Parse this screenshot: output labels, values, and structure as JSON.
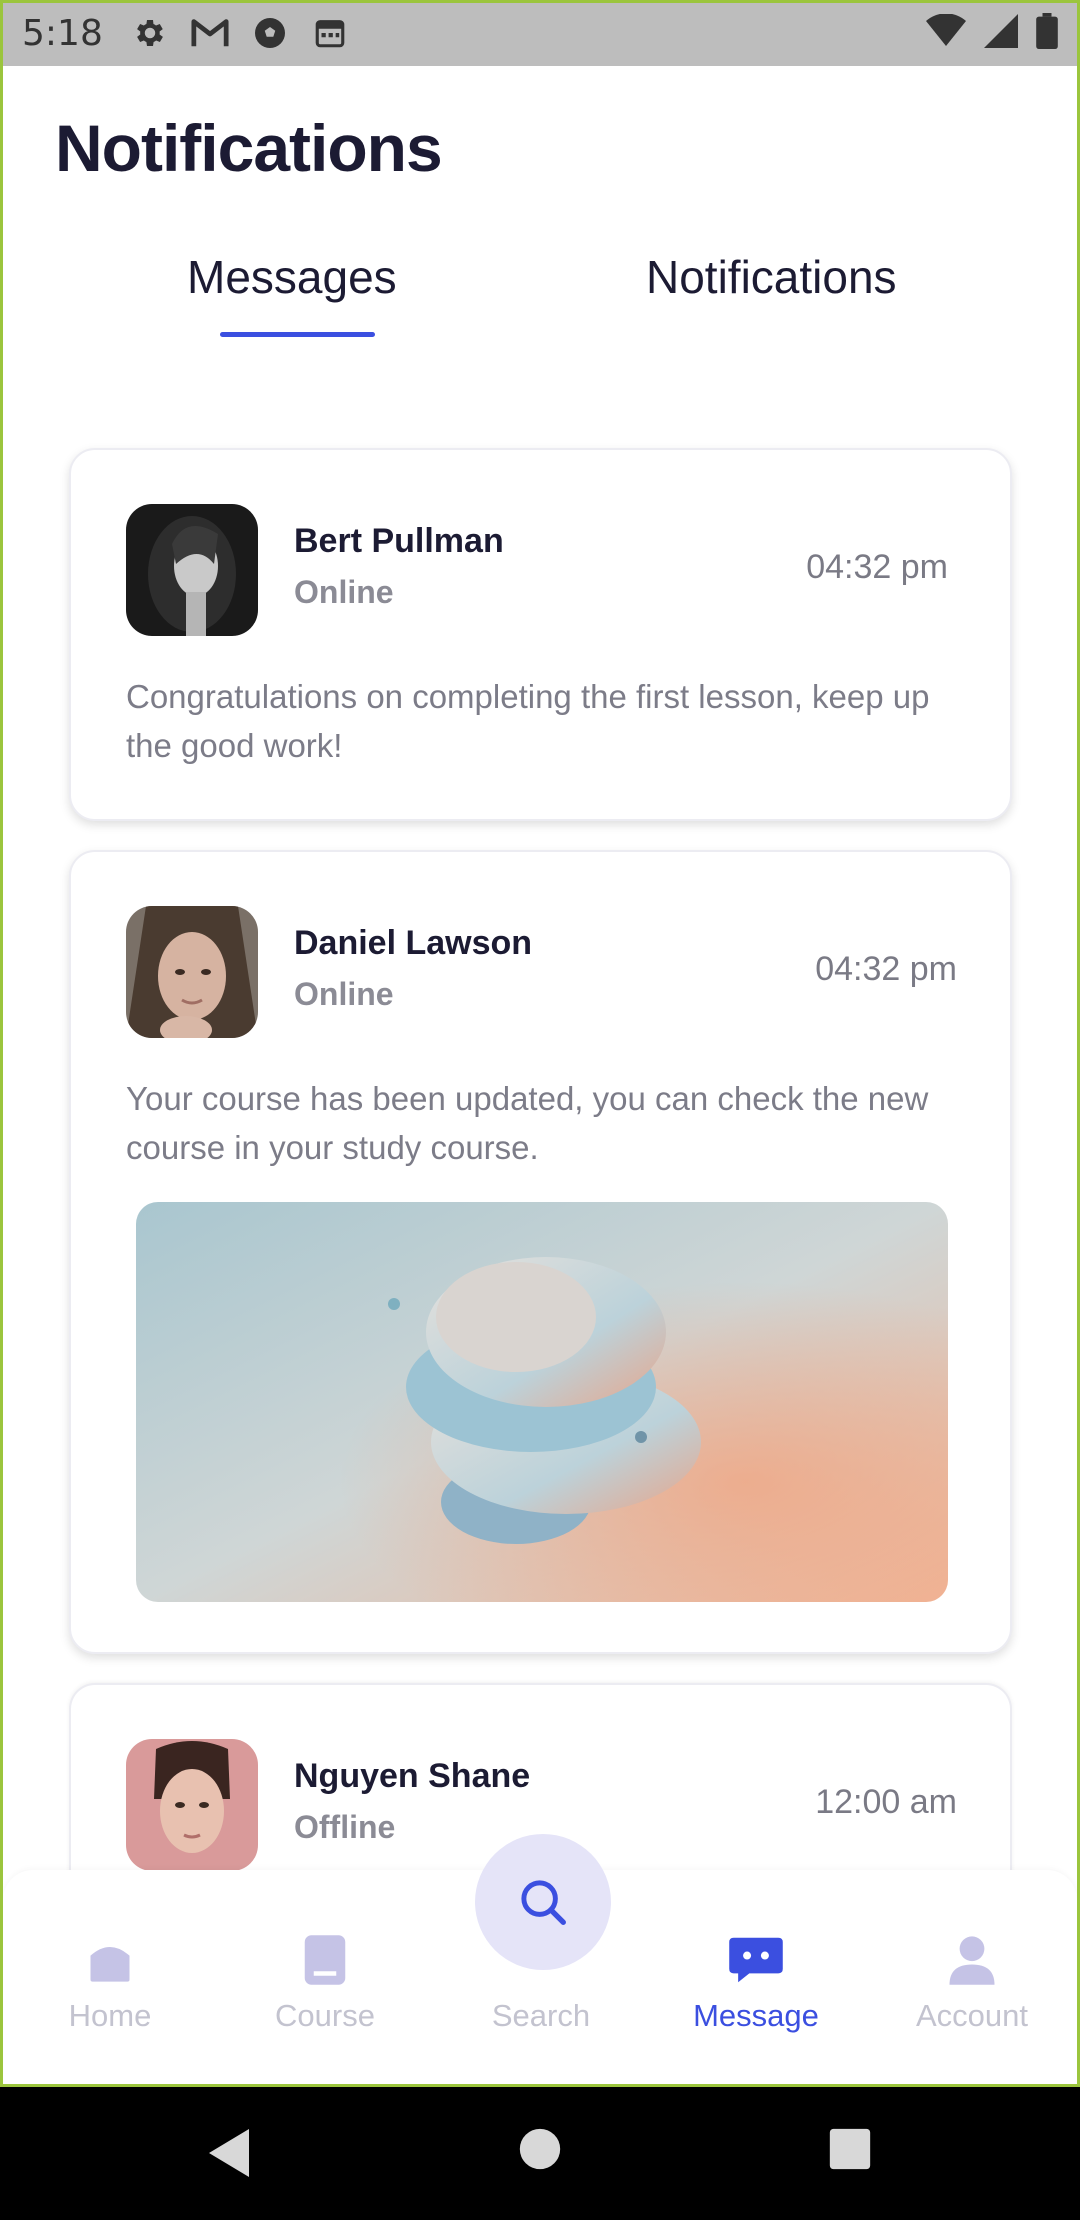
{
  "status_bar": {
    "time": "5:18",
    "left_icons": [
      "settings-icon",
      "gmail-icon",
      "soccer-ball-icon",
      "calendar-icon"
    ],
    "right_icons": [
      "wifi-icon",
      "signal-icon",
      "battery-icon"
    ]
  },
  "page": {
    "title": "Notifications"
  },
  "tabs": [
    {
      "label": "Messages",
      "active": true
    },
    {
      "label": "Notifications",
      "active": false
    }
  ],
  "messages": [
    {
      "name": "Bert Pullman",
      "status": "Online",
      "time": "04:32 pm",
      "text": "Congratulations on completing the first lesson, keep up the good work!",
      "has_image": false
    },
    {
      "name": "Daniel Lawson",
      "status": "Online",
      "time": "04:32 pm",
      "text": "Your course has been updated, you can check the new course in your study course.",
      "has_image": true
    },
    {
      "name": "Nguyen Shane",
      "status": "Offline",
      "time": "12:00 am",
      "text": "",
      "has_image": false
    }
  ],
  "bottom_nav": [
    {
      "label": "Home",
      "icon": "home-icon",
      "active": false
    },
    {
      "label": "Course",
      "icon": "book-icon",
      "active": false
    },
    {
      "label": "Search",
      "icon": "search-icon",
      "active": false
    },
    {
      "label": "Message",
      "icon": "chat-bubble-icon",
      "active": true
    },
    {
      "label": "Account",
      "icon": "person-icon",
      "active": false
    }
  ],
  "colors": {
    "accent": "#3b4fe0",
    "title_text": "#1c1b33",
    "muted_text": "#7c7c88",
    "inactive_nav": "#c3c3cf",
    "search_bubble": "#e5e4f8"
  }
}
